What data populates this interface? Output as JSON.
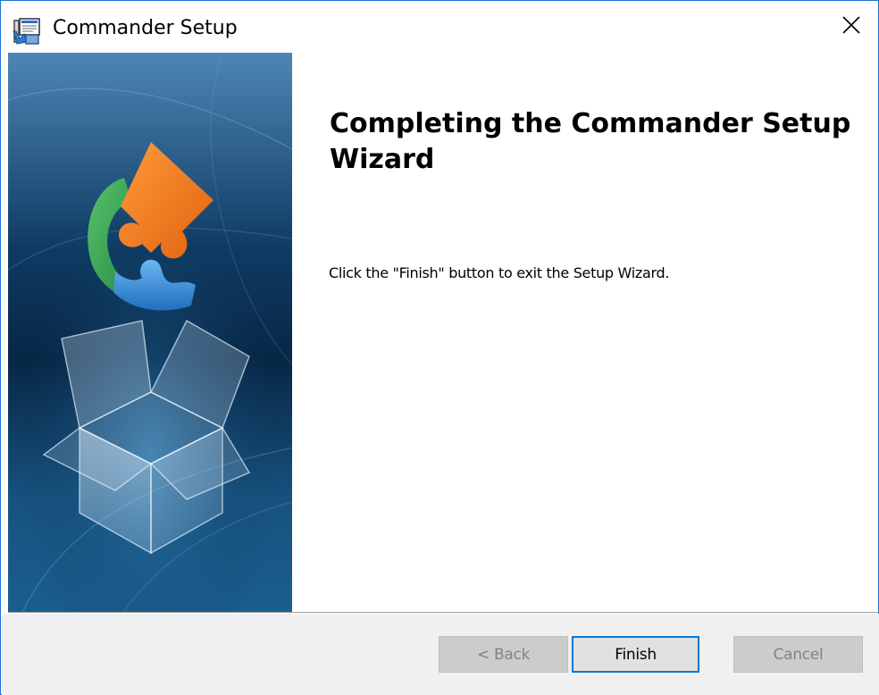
{
  "window": {
    "title": "Commander Setup",
    "icon": "setup-installer-icon",
    "close_icon": "close-icon"
  },
  "banner": {
    "image": "puzzle-box-banner"
  },
  "content": {
    "heading": "Completing the Commander Setup Wizard",
    "body": "Click the \"Finish\" button to exit the Setup Wizard."
  },
  "buttons": {
    "back": "< Back",
    "finish": "Finish",
    "cancel": "Cancel"
  },
  "colors": {
    "accent": "#0078d7",
    "window_border": "#1e6fd6",
    "footer_bg": "#f0f0f0",
    "disabled_button": "#cccccc"
  }
}
